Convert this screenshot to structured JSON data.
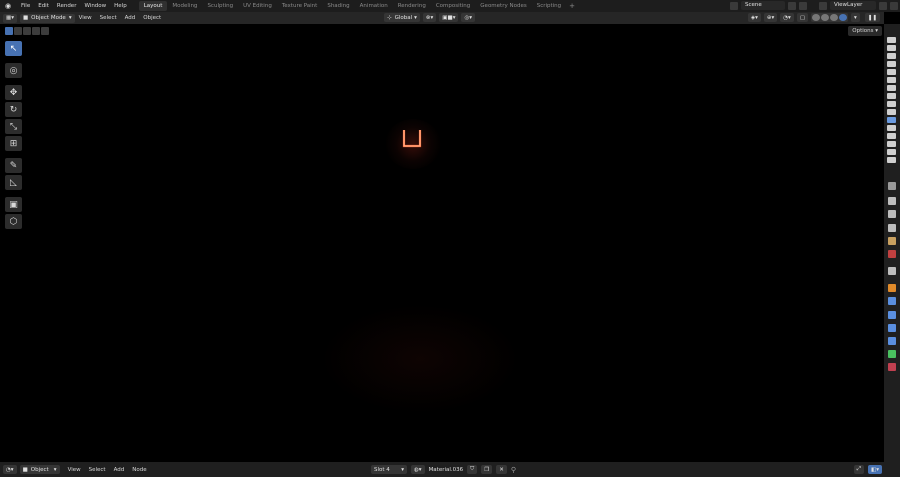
{
  "menu": {
    "items": [
      "File",
      "Edit",
      "Render",
      "Window",
      "Help"
    ]
  },
  "workspaces": {
    "tabs": [
      "Layout",
      "Modeling",
      "Sculpting",
      "UV Editing",
      "Texture Paint",
      "Shading",
      "Animation",
      "Rendering",
      "Compositing",
      "Geometry Nodes",
      "Scripting"
    ],
    "active": "Layout",
    "add_label": "+"
  },
  "scene": {
    "name": "Scene"
  },
  "view_layer": {
    "name": "ViewLayer"
  },
  "header": {
    "mode": "Object Mode",
    "menus": [
      "View",
      "Select",
      "Add",
      "Object"
    ],
    "orientation": "Global"
  },
  "viewport": {
    "options_label": "Options"
  },
  "bottom": {
    "editor_mode": "Object",
    "menus": [
      "View",
      "Select",
      "Add",
      "Node"
    ],
    "slot": "Slot 4",
    "material": "Material.036"
  },
  "colors": {
    "accent": "#4772b3",
    "lamp": "#ff6a3a"
  }
}
